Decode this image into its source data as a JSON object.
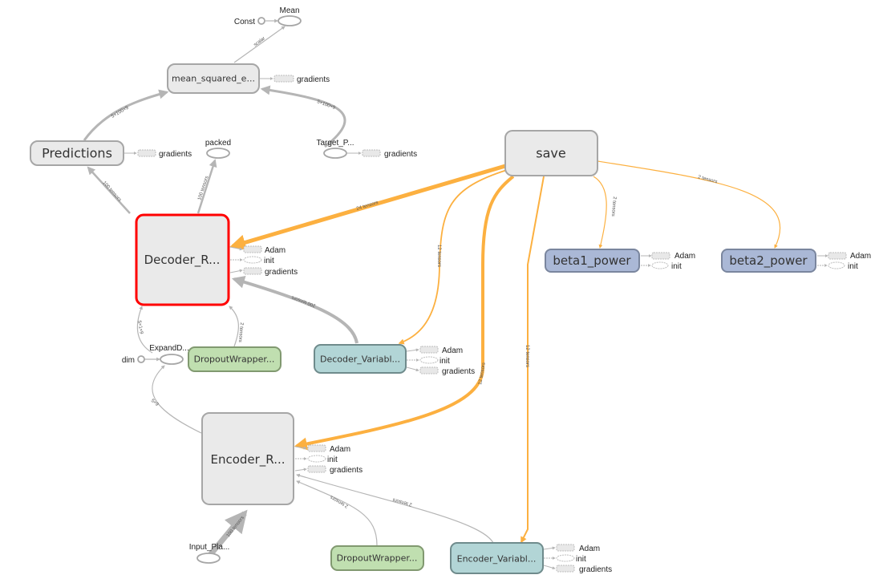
{
  "nodes": {
    "mean": "Mean",
    "const": "Const",
    "mse": "mean_squared_e...",
    "predictions": "Predictions",
    "packed": "packed",
    "target": "Target_P...",
    "save": "save",
    "decoder_r": "Decoder_R...",
    "beta1": "beta1_power",
    "beta2": "beta2_power",
    "decoder_var": "Decoder_Variabl...",
    "dropout_top": "DropoutWrapper...",
    "expand": "ExpandD...",
    "dim": "dim",
    "encoder_r": "Encoder_R...",
    "dropout_bottom": "DropoutWrapper...",
    "encoder_var": "Encoder_Variabl...",
    "input": "Input_Pla..."
  },
  "aux": {
    "adam": "Adam",
    "init": "init",
    "gradients": "gradients"
  },
  "edges": {
    "mse_mean": "scalar",
    "pred_mse": "5×100×9",
    "target_mse": "5×100×9",
    "dec_pred": "100 tensors",
    "dec_packed": "100 tensors",
    "save_dec": "24 tensors",
    "save_decvar": "12 tensors",
    "save_enc": "12 tensors",
    "save_encvar": "12 tensors",
    "save_beta1": "2 tensors",
    "save_beta2": "2 tensors",
    "decvar_dec": "200 tensors",
    "expand_dec": "5×1×9",
    "drop_dec": "2 tensors",
    "enc_expand": "5×9",
    "input_enc": "100 tensors",
    "drop_enc": "2 tensors",
    "encvar_enc": "2 tensors"
  },
  "colors": {
    "selected": "#ff0000",
    "save_edge": "#fcb040",
    "edge": "#b5b5b5",
    "variable": "#b2d5d6",
    "dropout": "#c0dfb0",
    "beta": "#aab8d6"
  }
}
